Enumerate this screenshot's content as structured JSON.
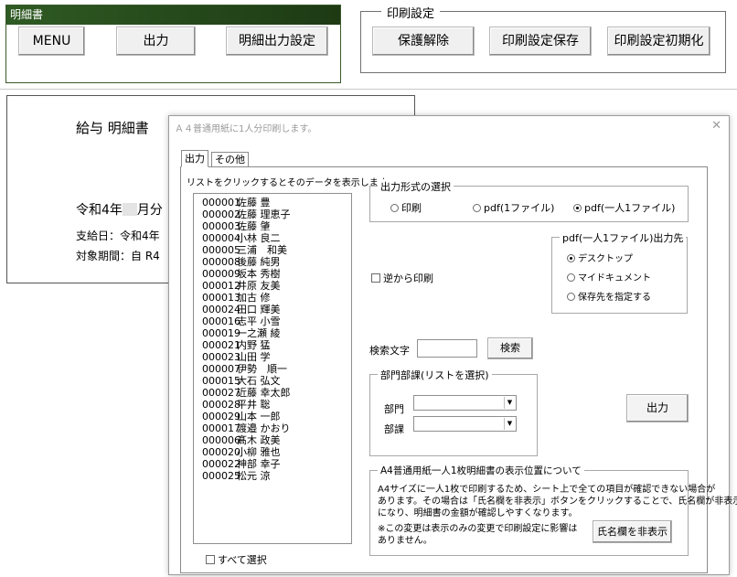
{
  "meisai_panel": {
    "title": "明細書",
    "buttons": [
      "MENU",
      "出力",
      "明細出力設定"
    ]
  },
  "print_settings": {
    "legend": "印刷設定",
    "buttons": [
      "保護解除",
      "印刷設定保存",
      "印刷設定初期化"
    ]
  },
  "sheet": {
    "heading": "給与 明細書",
    "period": "令和4年",
    "period_suffix": "月分",
    "pay_date": "支給日：令和4年",
    "target_period": "対象期間：自  R4"
  },
  "dialog": {
    "title": "Ａ４普通用紙に1人分印刷します。",
    "close_glyph": "✕",
    "tabs": [
      "出力",
      "その他"
    ],
    "list_hint": "リストをクリックするとそのデータを表示します。",
    "employees": [
      {
        "no": "000001",
        "name": "佐藤 豊"
      },
      {
        "no": "000002",
        "name": "佐藤 理恵子"
      },
      {
        "no": "000003",
        "name": "佐藤 肇"
      },
      {
        "no": "000004",
        "name": "小林 良二"
      },
      {
        "no": "000005",
        "name": "三浦　和美"
      },
      {
        "no": "000008",
        "name": "後藤 純男"
      },
      {
        "no": "000009",
        "name": "坂本 秀樹"
      },
      {
        "no": "000012",
        "name": "井原 友美"
      },
      {
        "no": "000013",
        "name": "加古 修"
      },
      {
        "no": "000024",
        "name": "田口 輝美"
      },
      {
        "no": "000016",
        "name": "志平 小雪"
      },
      {
        "no": "000019",
        "name": "一之瀬 綾"
      },
      {
        "no": "000021",
        "name": "内野 猛"
      },
      {
        "no": "000023",
        "name": "山田 学"
      },
      {
        "no": "000007",
        "name": "伊勢　順一"
      },
      {
        "no": "000015",
        "name": "大石 弘文"
      },
      {
        "no": "000027",
        "name": "近藤 幸太郎"
      },
      {
        "no": "000028",
        "name": "平井 聡"
      },
      {
        "no": "000029",
        "name": "山本 一郎"
      },
      {
        "no": "000017",
        "name": "渡邉 かおり"
      },
      {
        "no": "000006",
        "name": "髙木 政美"
      },
      {
        "no": "000020",
        "name": "小柳 雅也"
      },
      {
        "no": "000022",
        "name": "神部 幸子"
      },
      {
        "no": "000025",
        "name": "松元 涼"
      }
    ],
    "select_all_label": "すべて選択",
    "output_format": {
      "legend": "出力形式の選択",
      "options": [
        "印刷",
        "pdf(1ファイル)",
        "pdf(一人1ファイル)"
      ],
      "selected_index": 2
    },
    "pdf_destination": {
      "legend": "pdf(一人1ファイル)出力先",
      "options": [
        "デスクトップ",
        "マイドキュメント",
        "保存先を指定する"
      ],
      "selected_index": 0
    },
    "reverse_print_label": "逆から印刷",
    "search": {
      "label": "検索文字",
      "value": "",
      "button": "検索"
    },
    "dept_group": {
      "legend": "部門部課(リストを選択)",
      "dept_label": "部門",
      "section_label": "部課",
      "dept_value": "",
      "section_value": ""
    },
    "output_button": "出力",
    "a4_group": {
      "legend": "A4普通用紙一人1枚明細書の表示位置について",
      "text_lines": [
        "A4サイズに一人1枚で印刷するため、シート上で全ての項目が確認できない場合が",
        "あります。その場合は「氏名欄を非表示」ボタンをクリックすることで、氏名欄が非表示",
        "になり、明細書の金額が確認しやすくなります。"
      ],
      "note_lines": [
        "※この変更は表示のみの変更で印刷設定に影響は",
        "ありません。"
      ],
      "hide_name_button": "氏名欄を非表示"
    }
  }
}
